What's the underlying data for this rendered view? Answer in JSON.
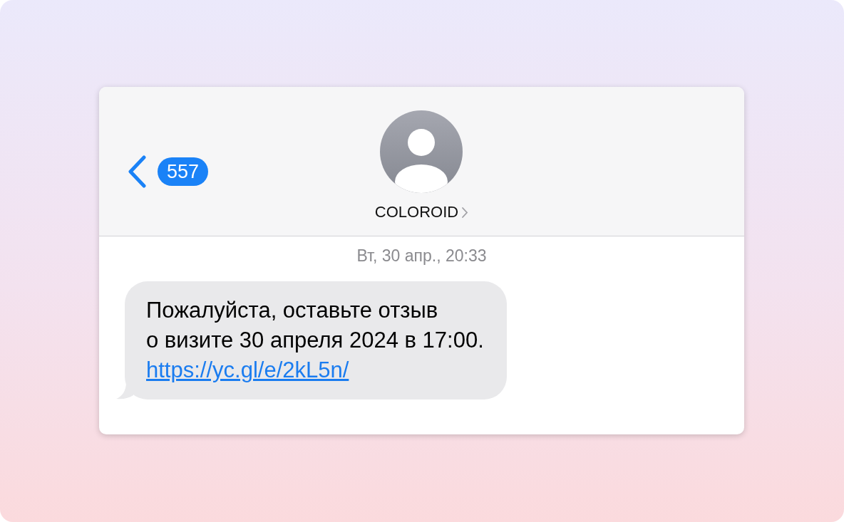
{
  "header": {
    "back_badge": "557",
    "contact_name": "COLOROID"
  },
  "timestamp": "Вт, 30 апр., 20:33",
  "messages": [
    {
      "lines": [
        "Пожалуйста, оставьте отзыв",
        "о визите 30 апреля 2024 в 17:00."
      ],
      "link": "https://yc.gl/e/2kL5n/"
    }
  ]
}
